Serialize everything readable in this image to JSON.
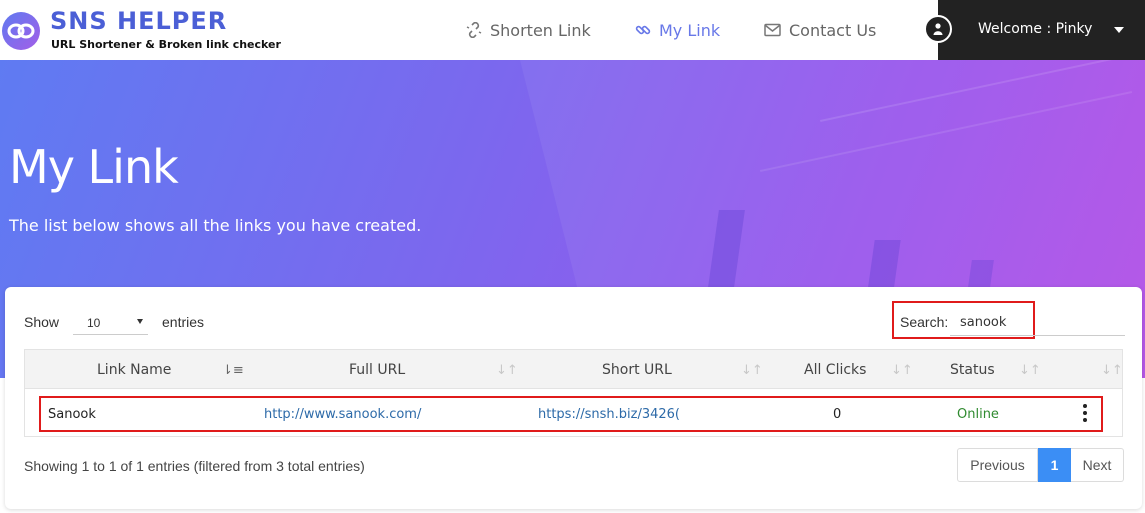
{
  "brand": {
    "title": "SNS HELPER",
    "tagline": "URL Shortener & Broken link checker",
    "accent": "#4b5fd6"
  },
  "nav": {
    "items": [
      {
        "label": "Shorten Link",
        "icon": "broken-link-icon",
        "active": false
      },
      {
        "label": "My Link",
        "icon": "link-icon",
        "active": true
      },
      {
        "label": "Contact Us",
        "icon": "envelope-icon",
        "active": false
      }
    ],
    "active_color": "#6878e8"
  },
  "user": {
    "welcome": "Welcome : Pinky",
    "icon": "user-icon"
  },
  "hero": {
    "title": "My Link",
    "subtitle": "The list below shows all the links you have created."
  },
  "controls": {
    "show_label": "Show",
    "page_length": "10",
    "entries_label": "entries",
    "search_label": "Search:",
    "search_value": "sanook"
  },
  "table": {
    "columns": [
      "Link Name",
      "Full URL",
      "Short URL",
      "All Clicks",
      "Status"
    ],
    "rows": [
      {
        "name": "Sanook",
        "full_url": "http://www.sanook.com/",
        "short_url": "https://snsh.biz/3426(",
        "clicks": "0",
        "status": "Online"
      }
    ],
    "status_color": "#2f8a2f",
    "highlight_color": "#e01b1b"
  },
  "footer": {
    "info": "Showing 1 to 1 of 1 entries (filtered from 3 total entries)",
    "pagination": {
      "previous": "Previous",
      "current": "1",
      "next": "Next"
    },
    "active_page_color": "#3b8ef5"
  }
}
